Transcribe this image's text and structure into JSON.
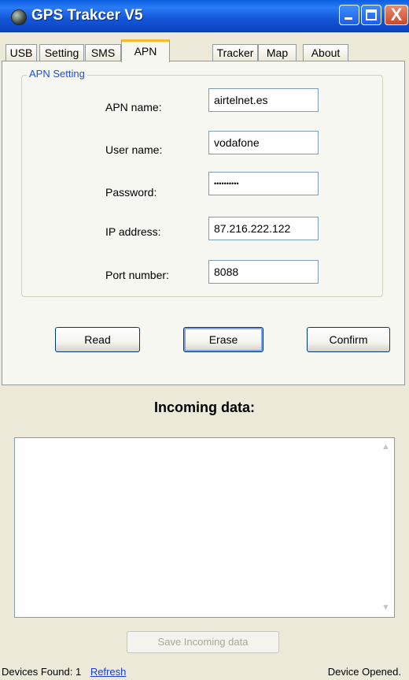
{
  "window": {
    "title": "GPS Trakcer V5",
    "close_glyph": "X"
  },
  "tabs": [
    {
      "label": "USB"
    },
    {
      "label": "Setting"
    },
    {
      "label": "SMS"
    },
    {
      "label": "APN",
      "active": true
    },
    {
      "label": "Tracker"
    },
    {
      "label": "Map"
    },
    {
      "label": "About"
    }
  ],
  "apn": {
    "group_title": "APN Setting",
    "fields": {
      "apn_name": {
        "label": "APN name:",
        "value": "airtelnet.es"
      },
      "user_name": {
        "label": "User name:",
        "value": "vodafone"
      },
      "password": {
        "label": "Password:",
        "value": "••••••••••"
      },
      "ip_address": {
        "label": "IP address:",
        "value": "87.216.222.122"
      },
      "port_number": {
        "label": "Port number:",
        "value": "8088"
      }
    }
  },
  "buttons": {
    "read": "Read",
    "erase": "Erase",
    "confirm": "Confirm"
  },
  "incoming": {
    "title": "Incoming data:",
    "content": "",
    "scroll_up": "▲",
    "scroll_down": "▼",
    "save_label": "Save Incoming data"
  },
  "status": {
    "devices_found_label": "Devices Found:",
    "devices_found_count": "1",
    "refresh_label": "Refresh",
    "device_state": "Device Opened."
  },
  "colors": {
    "titlebar": "#0b55e0",
    "active_tab_accent": "#f9b931",
    "group_title": "#1c4fd8",
    "link": "#1a3fc9"
  },
  "icons": [
    "gps-app-icon",
    "minimize-icon",
    "maximize-icon",
    "close-icon",
    "scroll-up-arrow-icon",
    "scroll-down-arrow-icon"
  ]
}
